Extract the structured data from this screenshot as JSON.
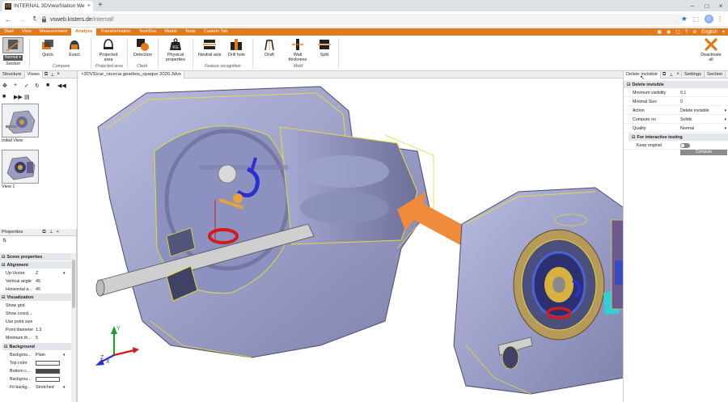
{
  "browser": {
    "tab_title": "INTERNAL 3DViewStation WebV",
    "favicon_text": "VS",
    "url_host": "vsweb.kisters.de",
    "url_path": "/internal/",
    "profile_initial": "G"
  },
  "menu": {
    "items": [
      "Start",
      "View",
      "Measurement",
      "Analyze",
      "Transformation",
      "TechDoc",
      "Model",
      "Tools",
      "Custom Tab"
    ],
    "active_index": 3,
    "language": "English"
  },
  "ribbon": {
    "normal_label": "Normal",
    "section_label": "Section",
    "buttons": {
      "quick": "Quick",
      "exact": "Exact",
      "projected_area": "Projected area",
      "detection": "Detection",
      "physical_properties": "Physical properties",
      "neutral_axis": "Neutral axis",
      "drill_hole": "Drill hole",
      "draft": "Draft",
      "wall_thickness": "Wall thickness",
      "split": "Split",
      "deactivate_all": "Deactivate all"
    },
    "groups": {
      "compare": "Compare",
      "projected_area": "Projected area",
      "clash": "Clash",
      "feature_recognition": "Feature recognition",
      "mold": "Mold"
    },
    "icon_text_kg": "KG"
  },
  "left_panel": {
    "tabs": [
      "Structure",
      "Views"
    ],
    "views": [
      {
        "label": "Initial View"
      },
      {
        "label": "View 1"
      }
    ]
  },
  "properties": {
    "title": "Properties",
    "scene_properties": "Scene properties",
    "alignment": "Alignment",
    "up_vector": {
      "label": "Up-Vector",
      "value": "Z"
    },
    "vertical_angle": {
      "label": "Vertical angle",
      "value": "45"
    },
    "horizontal_angle": {
      "label": "Horizontal a...",
      "value": "45"
    },
    "visualization": "Visualization",
    "show_grid": {
      "label": "Show grid",
      "on": false
    },
    "show_coord": {
      "label": "Show coord...",
      "on": true
    },
    "use_point_size": {
      "label": "Use point size",
      "on": true
    },
    "point_diameter": {
      "label": "Point diameter",
      "value": "1.3"
    },
    "minimum_th": {
      "label": "Minimum th...",
      "value": "5"
    },
    "background": "Background",
    "background_type": {
      "label": "Backgrou...",
      "value": "Plain"
    },
    "top_color": {
      "label": "Top color",
      "color": "#f4f4f4"
    },
    "bottom_color": {
      "label": "Bottom c...",
      "color": "#4a4a4a"
    },
    "background_image": {
      "label": "Backgrou..."
    },
    "fit_background": {
      "label": "Fit backg...",
      "value": "Stretched"
    }
  },
  "viewport": {
    "doc_tab": "×3DVS\\car_racecar.gearbox_opaque 2020.3dvs",
    "axes": {
      "x": "X",
      "y": "Y",
      "z": "Z"
    }
  },
  "right_panel": {
    "tabs": [
      "Delete invisible",
      "Settings",
      "Section"
    ],
    "section_title": "Delete invisible",
    "rows": [
      {
        "label": "Minimum visibility",
        "value": "0.1"
      },
      {
        "label": "Minimal Size",
        "value": "0"
      },
      {
        "label": "Action",
        "value": "Delete invisible",
        "dropdown": true
      },
      {
        "label": "Compute on",
        "value": "Solids",
        "dropdown": true
      },
      {
        "label": "Quality",
        "value": "Normal",
        "dropdown": true
      }
    ],
    "interactive_section": "For interactive testing",
    "keep_original": {
      "label": "Keep original",
      "on": false
    },
    "compute_button": "Compute"
  },
  "colors": {
    "accent": "#e07a1e",
    "casing": "#9a9fc8",
    "arrow": "#f08a3c"
  }
}
